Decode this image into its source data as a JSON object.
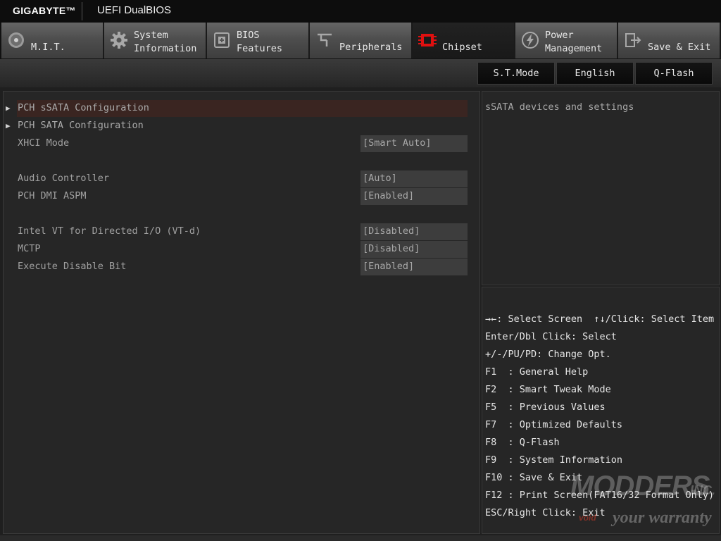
{
  "header": {
    "brand": "GIGABYTE™",
    "product": "UEFI DualBIOS"
  },
  "tabs": [
    {
      "id": "mit",
      "lines": [
        "M.I.T."
      ],
      "icon": "gauge-icon"
    },
    {
      "id": "system",
      "lines": [
        "System",
        "Information"
      ],
      "icon": "gear-icon"
    },
    {
      "id": "bios",
      "lines": [
        "BIOS",
        "Features"
      ],
      "icon": "chip-icon"
    },
    {
      "id": "peripherals",
      "lines": [
        "Peripherals"
      ],
      "icon": "plug-icon"
    },
    {
      "id": "chipset",
      "lines": [
        "Chipset"
      ],
      "icon": "chipset-icon",
      "active": true
    },
    {
      "id": "power",
      "lines": [
        "Power",
        "Management"
      ],
      "icon": "lightning-icon"
    },
    {
      "id": "save",
      "lines": [
        "Save & Exit"
      ],
      "icon": "exit-icon"
    }
  ],
  "subbar": {
    "st_mode": "S.T.Mode",
    "language": "English",
    "qflash": "Q-Flash"
  },
  "settings": [
    {
      "name": "PCH sSATA Configuration",
      "submenu": true,
      "selected": true
    },
    {
      "name": "PCH SATA Configuration",
      "submenu": true
    },
    {
      "name": "XHCI Mode",
      "value": "[Smart Auto]"
    },
    {
      "name": "Audio Controller",
      "value": "[Auto]"
    },
    {
      "name": "PCH DMI ASPM",
      "value": "[Enabled]"
    },
    {
      "name": "Intel VT for Directed I/O (VT-d)",
      "value": "[Disabled]"
    },
    {
      "name": "MCTP",
      "value": "[Disabled]"
    },
    {
      "name": "Execute Disable Bit",
      "value": "[Enabled]"
    }
  ],
  "help": {
    "description": "sSATA devices and settings"
  },
  "keys": [
    "→←: Select Screen  ↑↓/Click: Select Item",
    "Enter/Dbl Click: Select",
    "+/-/PU/PD: Change Opt.",
    "F1  : General Help",
    "F2  : Smart Tweak Mode",
    "F5  : Previous Values",
    "F7  : Optimized Defaults",
    "F8  : Q-Flash",
    "F9  : System Information",
    "F10 : Save & Exit",
    "F12 : Print Screen(FAT16/32 Format Only)",
    "ESC/Right Click: Exit"
  ],
  "watermark": {
    "main": "MODDERS",
    "inc": "INC.",
    "void": "void",
    "tagline": "your warranty"
  },
  "colors": {
    "accent_red": "#e01010",
    "selected_row": "#3a2521"
  }
}
